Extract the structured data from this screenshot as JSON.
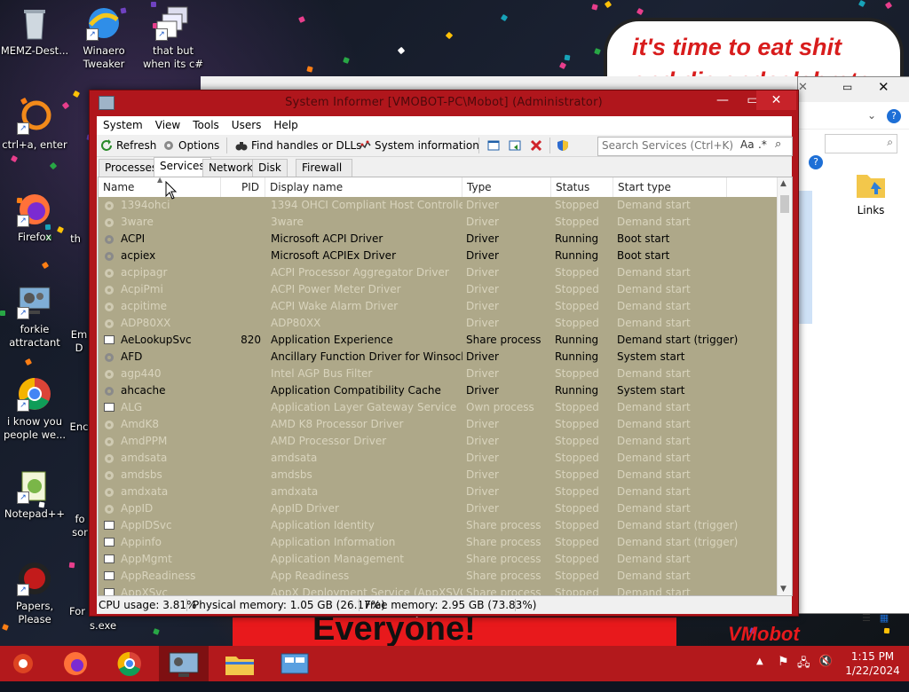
{
  "desktop": {
    "icons": [
      {
        "label": "MEMZ-Dest...",
        "icon": "recycle-bin-icon"
      },
      {
        "label": "Winaero Tweaker",
        "icon": "winaero-icon"
      },
      {
        "label": "that but when its c#",
        "icon": "windows-stack-icon"
      },
      {
        "label": "ctrl+a, enter",
        "icon": "orange-ring-icon"
      },
      {
        "label": "Firefox",
        "icon": "firefox-icon"
      },
      {
        "label": "forkie attractant",
        "icon": "monitor-gear-icon"
      },
      {
        "label": "i know you people we...",
        "icon": "chrome-icon"
      },
      {
        "label": "Notepad++",
        "icon": "notepadpp-icon"
      },
      {
        "label": "Papers, Please",
        "icon": "papers-please-icon"
      },
      {
        "label": "th",
        "icon": "partial-icon"
      },
      {
        "label": "Em D",
        "icon": "partial-icon"
      },
      {
        "label": "Enc",
        "icon": "partial-icon"
      },
      {
        "label": "fo sor",
        "icon": "partial-icon"
      },
      {
        "label": "For",
        "icon": "partial-icon"
      },
      {
        "label": "s.exe",
        "icon": "partial-icon"
      },
      {
        "label": "Links",
        "icon": "folder-icon"
      }
    ],
    "meme_text_line1": "it's time to eat shit",
    "meme_text_line2": "and die andcelebrate",
    "banner_text": "Everyone!",
    "vmobot_text": "VMobot"
  },
  "window": {
    "title": "System Informer [VMOBOT-PC\\Mobot] (Administrator)",
    "menu": [
      "System",
      "View",
      "Tools",
      "Users",
      "Help"
    ],
    "toolbar": {
      "refresh": "Refresh",
      "options": "Options",
      "find_handles": "Find handles or DLLs",
      "system_information": "System information"
    },
    "search_placeholder": "Search Services (Ctrl+K)",
    "search_aa": "Aa",
    "tabs": [
      "Processes",
      "Services",
      "Network",
      "Disk",
      "Firewall"
    ],
    "active_tab": "Services",
    "columns": [
      "Name",
      "PID",
      "Display name",
      "Type",
      "Status",
      "Start type"
    ],
    "rows": [
      {
        "name": "1394ohci",
        "pid": "",
        "display": "1394 OHCI Compliant Host Controller",
        "type": "Driver",
        "status": "Stopped",
        "start": "Demand start",
        "dim": true,
        "icon": "gear"
      },
      {
        "name": "3ware",
        "pid": "",
        "display": "3ware",
        "type": "Driver",
        "status": "Stopped",
        "start": "Demand start",
        "dim": true,
        "icon": "gear"
      },
      {
        "name": "ACPI",
        "pid": "",
        "display": "Microsoft ACPI Driver",
        "type": "Driver",
        "status": "Running",
        "start": "Boot start",
        "dim": false,
        "icon": "gear"
      },
      {
        "name": "acpiex",
        "pid": "",
        "display": "Microsoft ACPIEx Driver",
        "type": "Driver",
        "status": "Running",
        "start": "Boot start",
        "dim": false,
        "icon": "gear"
      },
      {
        "name": "acpipagr",
        "pid": "",
        "display": "ACPI Processor Aggregator Driver",
        "type": "Driver",
        "status": "Stopped",
        "start": "Demand start",
        "dim": true,
        "icon": "gear"
      },
      {
        "name": "AcpiPmi",
        "pid": "",
        "display": "ACPI Power Meter Driver",
        "type": "Driver",
        "status": "Stopped",
        "start": "Demand start",
        "dim": true,
        "icon": "gear"
      },
      {
        "name": "acpitime",
        "pid": "",
        "display": "ACPI Wake Alarm Driver",
        "type": "Driver",
        "status": "Stopped",
        "start": "Demand start",
        "dim": true,
        "icon": "gear"
      },
      {
        "name": "ADP80XX",
        "pid": "",
        "display": "ADP80XX",
        "type": "Driver",
        "status": "Stopped",
        "start": "Demand start",
        "dim": true,
        "icon": "gear"
      },
      {
        "name": "AeLookupSvc",
        "pid": "820",
        "display": "Application Experience",
        "type": "Share process",
        "status": "Running",
        "start": "Demand start (trigger)",
        "dim": false,
        "icon": "svc"
      },
      {
        "name": "AFD",
        "pid": "",
        "display": "Ancillary Function Driver for Winsock",
        "type": "Driver",
        "status": "Running",
        "start": "System start",
        "dim": false,
        "icon": "gear"
      },
      {
        "name": "agp440",
        "pid": "",
        "display": "Intel AGP Bus Filter",
        "type": "Driver",
        "status": "Stopped",
        "start": "Demand start",
        "dim": true,
        "icon": "gear"
      },
      {
        "name": "ahcache",
        "pid": "",
        "display": "Application Compatibility Cache",
        "type": "Driver",
        "status": "Running",
        "start": "System start",
        "dim": false,
        "icon": "gear"
      },
      {
        "name": "ALG",
        "pid": "",
        "display": "Application Layer Gateway Service",
        "type": "Own process",
        "status": "Stopped",
        "start": "Demand start",
        "dim": true,
        "icon": "svc"
      },
      {
        "name": "AmdK8",
        "pid": "",
        "display": "AMD K8 Processor Driver",
        "type": "Driver",
        "status": "Stopped",
        "start": "Demand start",
        "dim": true,
        "icon": "gear"
      },
      {
        "name": "AmdPPM",
        "pid": "",
        "display": "AMD Processor Driver",
        "type": "Driver",
        "status": "Stopped",
        "start": "Demand start",
        "dim": true,
        "icon": "gear"
      },
      {
        "name": "amdsata",
        "pid": "",
        "display": "amdsata",
        "type": "Driver",
        "status": "Stopped",
        "start": "Demand start",
        "dim": true,
        "icon": "gear"
      },
      {
        "name": "amdsbs",
        "pid": "",
        "display": "amdsbs",
        "type": "Driver",
        "status": "Stopped",
        "start": "Demand start",
        "dim": true,
        "icon": "gear"
      },
      {
        "name": "amdxata",
        "pid": "",
        "display": "amdxata",
        "type": "Driver",
        "status": "Stopped",
        "start": "Demand start",
        "dim": true,
        "icon": "gear"
      },
      {
        "name": "AppID",
        "pid": "",
        "display": "AppID Driver",
        "type": "Driver",
        "status": "Stopped",
        "start": "Demand start",
        "dim": true,
        "icon": "gear"
      },
      {
        "name": "AppIDSvc",
        "pid": "",
        "display": "Application Identity",
        "type": "Share process",
        "status": "Stopped",
        "start": "Demand start (trigger)",
        "dim": true,
        "icon": "svc"
      },
      {
        "name": "Appinfo",
        "pid": "",
        "display": "Application Information",
        "type": "Share process",
        "status": "Stopped",
        "start": "Demand start (trigger)",
        "dim": true,
        "icon": "svc"
      },
      {
        "name": "AppMgmt",
        "pid": "",
        "display": "Application Management",
        "type": "Share process",
        "status": "Stopped",
        "start": "Demand start",
        "dim": true,
        "icon": "svc"
      },
      {
        "name": "AppReadiness",
        "pid": "",
        "display": "App Readiness",
        "type": "Share process",
        "status": "Stopped",
        "start": "Demand start",
        "dim": true,
        "icon": "svc"
      },
      {
        "name": "AppXSvc",
        "pid": "",
        "display": "AppX Deployment Service (AppXSVC)",
        "type": "Share process",
        "status": "Stopped",
        "start": "Demand start",
        "dim": true,
        "icon": "svc"
      }
    ],
    "status": {
      "cpu": "CPU usage: 3.81%",
      "physical": "Physical memory: 1.05 GB (26.17%)",
      "free": "Free memory: 2.95 GB (73.83%)"
    }
  },
  "taskbar": {
    "apps": [
      "memz-icon",
      "firefox-icon",
      "chrome-icon",
      "system-informer-icon",
      "file-explorer-icon",
      "control-panel-icon"
    ],
    "time": "1:15 PM",
    "date": "1/22/2024"
  },
  "colors": {
    "accent": "#b0161c",
    "list_bg": "#aea889",
    "taskbar": "#b3191c"
  }
}
